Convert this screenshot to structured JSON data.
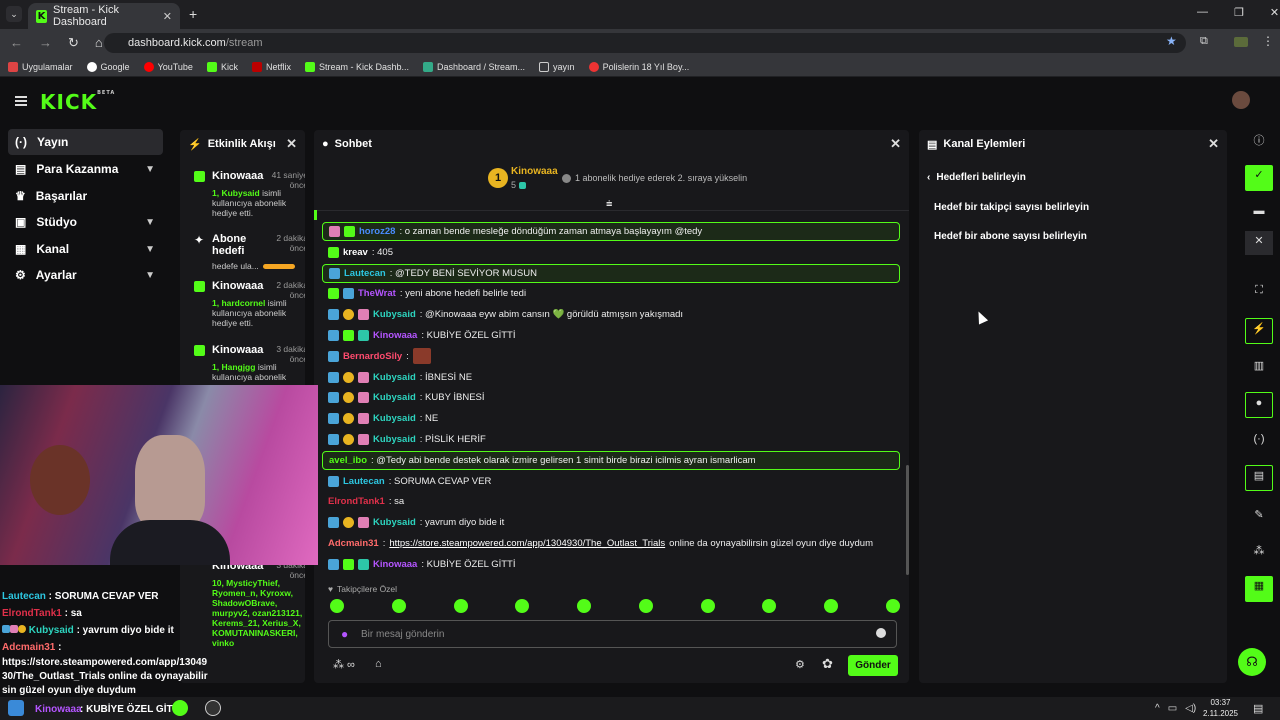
{
  "browser": {
    "tab_title": "Stream - Kick Dashboard",
    "url_host": "dashboard.kick.com",
    "url_path": "/stream",
    "bookmarks": [
      "Uygulamalar",
      "Google",
      "YouTube",
      "Kick",
      "Netflix",
      "Stream - Kick Dashb...",
      "Dashboard / Stream...",
      "yayın",
      "Polislerin 18 Yıl Boy..."
    ]
  },
  "brand": {
    "logo": "KICK",
    "beta": "BETA",
    "accent": "#53fc18"
  },
  "nav": [
    {
      "label": "Yayın",
      "active": true
    },
    {
      "label": "Para Kazanma",
      "chevron": true
    },
    {
      "label": "Başarılar"
    },
    {
      "label": "Stüdyo",
      "chevron": true
    },
    {
      "label": "Kanal",
      "chevron": true
    },
    {
      "label": "Ayarlar",
      "chevron": true
    }
  ],
  "activity": {
    "title": "Etkinlik Akışı",
    "items": [
      {
        "name": "Kinowaaa",
        "time": "41 saniye önce",
        "pre": "1, Kubysaid",
        "post": " isimli kullanıcıya abonelik hediye etti."
      },
      {
        "name": "Abone hedefi",
        "time": "2 dakika önce",
        "pre": "",
        "post": "hedefe ula..."
      },
      {
        "name": "Kinowaaa",
        "time": "2 dakika önce",
        "pre": "1, hardcornel",
        "post": " isimli kullanıcıya abonelik hediye etti."
      },
      {
        "name": "Kinowaaa",
        "time": "3 dakika önce",
        "pre": "1, Hangjgg",
        "post": " isimli kullanıcıya abonelik"
      },
      {
        "name": "Kinowaaa",
        "time": "3 dakika önce",
        "pre": "10, MysticyThief, Ryomen_n, Kyroxw, ShadowOBrave, murpyv2, ozan213121, Kerems_21, Xerius_X, KOMUTANINASKERI, vinko",
        "post": ""
      }
    ]
  },
  "chat": {
    "title": "Sohbet",
    "top_gifter": {
      "name": "Kinowaaa",
      "count": "5",
      "rank": "1",
      "note": "1 abonelik hediye ederek 2. sıraya yükselin"
    },
    "messages": [
      {
        "user": "horoz28",
        "color": "#4a8cff",
        "text": ": o zaman bende mesleğe döndüğüm zaman atmaya başlayayım @tedy",
        "hl": true,
        "badges": [
          "vip",
          "sub"
        ]
      },
      {
        "user": "kreav",
        "color": "#ffffff",
        "text": ": 405",
        "badges": [
          "sub"
        ]
      },
      {
        "user": "Lautecan",
        "color": "#2dc6e0",
        "text": ": @TEDY BENİ SEVİYOR MUSUN",
        "hl": true,
        "badges": [
          "mod"
        ]
      },
      {
        "user": "TheWrat",
        "color": "#b455ff",
        "text": ": yeni abone hedefi belirle tedi",
        "badges": [
          "sub",
          "mod"
        ]
      },
      {
        "user": "Kubysaid",
        "color": "#2dd4bf",
        "text": ": @Kinowaaa eyw abim cansın 💚 görüldü atmışsın yakışmadı",
        "badges": [
          "mod",
          "one",
          "vip"
        ]
      },
      {
        "user": "Kinowaaa",
        "color": "#b455ff",
        "text": ": KUBİYE ÖZEL GİTTİ",
        "badges": [
          "mod",
          "sub",
          "gift"
        ]
      },
      {
        "user": "BernardoSily",
        "color": "#ff4b6e",
        "text": ":",
        "badges": [
          "mod"
        ],
        "emote": true
      },
      {
        "user": "Kubysaid",
        "color": "#2dd4bf",
        "text": ": İBNESİ NE",
        "badges": [
          "mod",
          "one",
          "vip"
        ]
      },
      {
        "user": "Kubysaid",
        "color": "#2dd4bf",
        "text": ": KUBY İBNESİ",
        "badges": [
          "mod",
          "one",
          "vip"
        ]
      },
      {
        "user": "Kubysaid",
        "color": "#2dd4bf",
        "text": ": NE",
        "badges": [
          "mod",
          "one",
          "vip"
        ]
      },
      {
        "user": "Kubysaid",
        "color": "#2dd4bf",
        "text": ": PİSLİK HERİF",
        "badges": [
          "mod",
          "one",
          "vip"
        ]
      },
      {
        "user": "avel_ibo",
        "color": "#53fc18",
        "text": ": @Tedy abi bende destek olarak izmire gelirsen 1 simit birde birazi icilmis ayran ismarlicam",
        "hl": true,
        "badges": []
      },
      {
        "user": "Lautecan",
        "color": "#2dc6e0",
        "text": ": SORUMA CEVAP VER",
        "badges": [
          "mod"
        ]
      },
      {
        "user": "ElrondTank1",
        "color": "#e0304a",
        "text": ": sa",
        "badges": []
      },
      {
        "user": "Kubysaid",
        "color": "#2dd4bf",
        "text": ": yavrum diyo bide it",
        "badges": [
          "mod",
          "one",
          "vip"
        ]
      },
      {
        "user": "Adcmain31",
        "color": "#ff6b6b",
        "text": ": ",
        "link": "https://store.steampowered.com/app/1304930/The_Outlast_Trials",
        "tail": " online da oynayabilirsin güzel oyun diye duydum",
        "badges": []
      },
      {
        "user": "Kinowaaa",
        "color": "#b455ff",
        "text": ": KUBİYE ÖZEL GİTTİ",
        "badges": [
          "mod",
          "sub",
          "gift"
        ]
      }
    ],
    "emote_section": "Takipçilere Özel",
    "placeholder": "Bir mesaj gönderin",
    "send_label": "Gönder"
  },
  "actions": {
    "title": "Kanal Eylemleri",
    "back_label": "Hedefleri belirleyin",
    "options": [
      "Hedef bir takipçi sayısı belirleyin",
      "Hedef bir abone sayısı belirleyin"
    ]
  },
  "overlay": {
    "lines": [
      {
        "user": "Lautecan",
        "color": "#2dc6e0",
        "text": " : SORUMA CEVAP VER"
      },
      {
        "user": "ElrondTank1",
        "color": "#e0304a",
        "text": " : sa"
      },
      {
        "user": "Kubysaid",
        "color": "#2dd4bf",
        "text": " : yavrum diyo bide it"
      },
      {
        "user": "Adcmain31",
        "color": "#ff6b6b",
        "text": " :"
      }
    ],
    "long": "https://store.steampowered.com/app/1304930/The_Outlast_Trials online da oynayabilirsin güzel oyun diye duydum",
    "bottom_user": "Kinowaaa",
    "bottom_text": ": KUBİYE ÖZEL GİTTİ"
  },
  "taskbar": {
    "time": "03:37",
    "date": "2.11.2025"
  }
}
